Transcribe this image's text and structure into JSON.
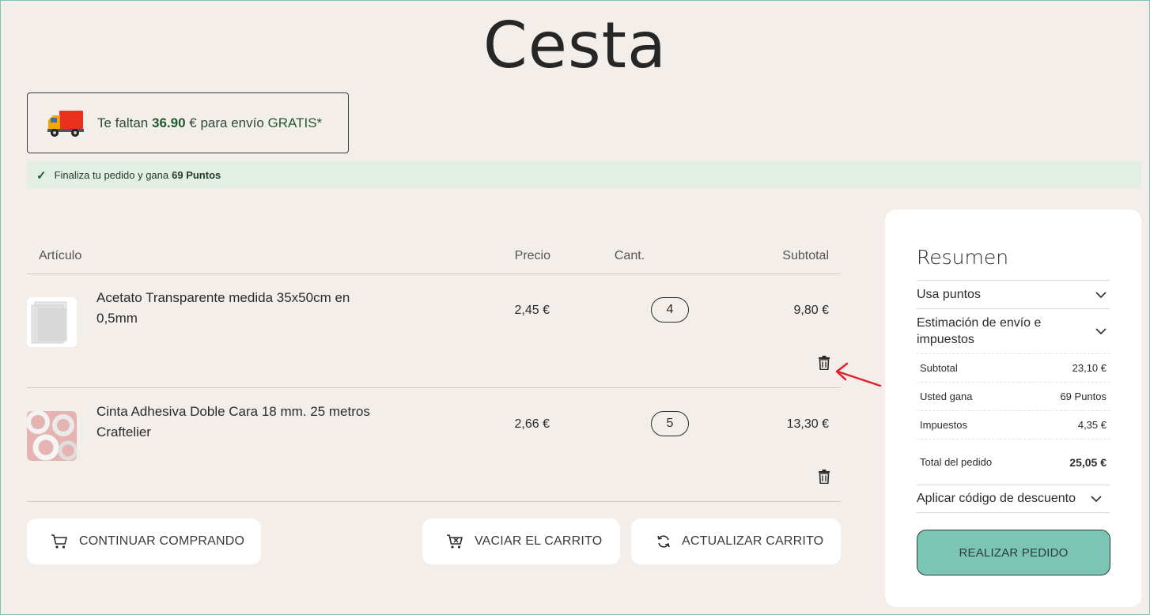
{
  "page": {
    "title": "Cesta"
  },
  "shipping_notice": {
    "prefix": "Te faltan",
    "amount": "36.90",
    "middle": "€ para envío",
    "free": "GRATIS*"
  },
  "points_banner": {
    "text": "Finaliza tu pedido y gana",
    "points": "69 Puntos"
  },
  "cart": {
    "headers": {
      "article": "Artículo",
      "price": "Precio",
      "qty": "Cant.",
      "subtotal": "Subtotal"
    },
    "items": [
      {
        "name": "Acetato Transparente medida 35x50cm en 0,5mm",
        "price": "2,45 €",
        "qty": "4",
        "subtotal": "9,80 €"
      },
      {
        "name": "Cinta Adhesiva Doble Cara 18 mm. 25 metros Craftelier",
        "price": "2,66 €",
        "qty": "5",
        "subtotal": "13,30 €"
      }
    ]
  },
  "buttons": {
    "continue": "CONTINUAR COMPRANDO",
    "empty": "VACIAR EL CARRITO",
    "update": "ACTUALIZAR CARRITO"
  },
  "summary": {
    "title": "Resumen",
    "use_points": "Usa puntos",
    "shipping_estimate": "Estimación de envío e impuestos",
    "lines": [
      {
        "label": "Subtotal",
        "value": "23,10 €"
      },
      {
        "label": "Usted gana",
        "value": "69 Puntos"
      },
      {
        "label": "Impuestos",
        "value": "4,35 €"
      }
    ],
    "total_label": "Total del pedido",
    "total_value": "25,05 €",
    "discount": "Aplicar código de descuento",
    "order_button": "REALIZAR PEDIDO"
  },
  "colors": {
    "background": "#f3eee9",
    "accent": "#7cc4b4",
    "green": "#1d5b2e",
    "annotation": "#e0202a"
  },
  "icons": [
    "truck-icon",
    "check-icon",
    "trash-icon",
    "cart-icon",
    "cart-empty-icon",
    "refresh-icon",
    "chevron-down-icon",
    "arrow-annotation"
  ]
}
